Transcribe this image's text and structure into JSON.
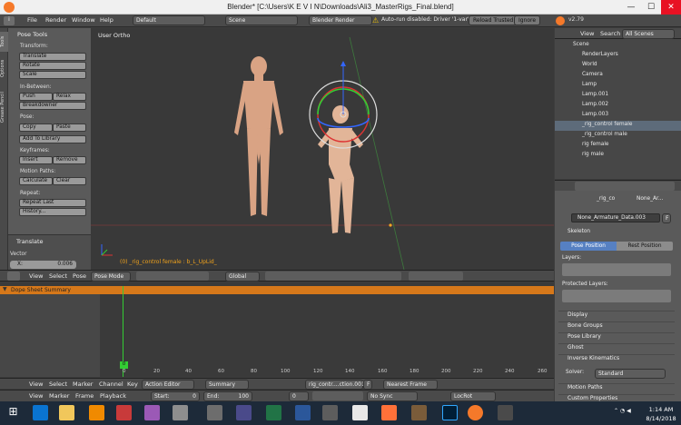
{
  "window": {
    "title": "Blender* [C:\\Users\\K E V I N\\Downloads\\Ali3_MasterRigs_Final.blend]"
  },
  "menubar": {
    "items": [
      "File",
      "Render",
      "Window",
      "Help"
    ],
    "layout": "Default",
    "scene": "Scene",
    "engine": "Blender Render",
    "warning": "Auto-run disabled: Driver '1-var'",
    "reload_btn": "Reload Trusted",
    "ignore_btn": "Ignore"
  },
  "tool_tabs": [
    "Tools",
    "Options",
    "Grease Pencil"
  ],
  "tools_panel": {
    "title": "Pose Tools",
    "transform_label": "Transform:",
    "translate": "Translate",
    "rotate": "Rotate",
    "scale": "Scale",
    "inbetween_label": "In-Between:",
    "push": "Push",
    "relax": "Relax",
    "breakdowner": "Breakdowner",
    "pose_label": "Pose:",
    "copy": "Copy",
    "paste": "Paste",
    "add_library": "Add To Library",
    "keyframes_label": "Keyframes:",
    "insert": "Insert",
    "remove": "Remove",
    "motion_label": "Motion Paths:",
    "calculate": "Calculate",
    "clear": "Clear",
    "repeat_label": "Repeat:",
    "repeat_last": "Repeat Last",
    "history": "History...",
    "op_title": "Translate",
    "vector_label": "Vector",
    "x_label": "X:",
    "x_value": "0.006"
  },
  "viewport": {
    "view_label": "User Ortho",
    "status": "(0) _rig_control female : b_L_UpLid_",
    "mode": "Pose Mode",
    "orientation": "Global",
    "menus": [
      "View",
      "Select",
      "Pose"
    ]
  },
  "dopesheet": {
    "summary": "Dope Sheet Summary",
    "current_frame": "0",
    "ticks": [
      "0",
      "20",
      "40",
      "60",
      "80",
      "100",
      "120",
      "140",
      "160",
      "180",
      "200",
      "220",
      "240",
      "260"
    ],
    "menus": [
      "View",
      "Select",
      "Marker",
      "Channel",
      "Key"
    ],
    "mode": "Action Editor",
    "summary_btn": "Summary",
    "action": "rig_contr....ction.001",
    "key_btn": "F",
    "interp": "Nearest Frame"
  },
  "timeline": {
    "menus": [
      "View",
      "Marker",
      "Frame",
      "Playback"
    ],
    "start_label": "Start:",
    "start_value": "0",
    "end_label": "End:",
    "end_value": "100",
    "current": "0",
    "sync": "No Sync",
    "keying": "LocRot"
  },
  "outliner": {
    "tabs": [
      "View",
      "Search",
      "All Scenes"
    ],
    "rows": [
      "Scene",
      "RenderLayers",
      "World",
      "Camera",
      "Lamp",
      "Lamp.001",
      "Lamp.002",
      "Lamp.003",
      "_rig_control female",
      "_rig_control male",
      "rig female",
      "rig male"
    ]
  },
  "properties": {
    "breadcrumb_obj": "_rig_co",
    "breadcrumb_data": "None_Ar...",
    "data_name": "None_Armature_Data.003",
    "data_btn": "F",
    "skeleton": "Skeleton",
    "pose_position": "Pose Position",
    "rest_position": "Rest Position",
    "layers_label": "Layers:",
    "protected_label": "Protected Layers:",
    "sections": [
      "Display",
      "Bone Groups",
      "Pose Library",
      "Ghost"
    ],
    "ik": "Inverse Kinematics",
    "solver_label": "Solver:",
    "solver_value": "Standard",
    "sections2": [
      "Motion Paths",
      "Custom Properties"
    ]
  },
  "taskbar": {
    "time": "1:14 AM",
    "date": "8/14/2018",
    "colors": {
      "bg": "#1d2a39",
      "blender_accent": "#f5792a",
      "selection": "#d6781a"
    }
  }
}
